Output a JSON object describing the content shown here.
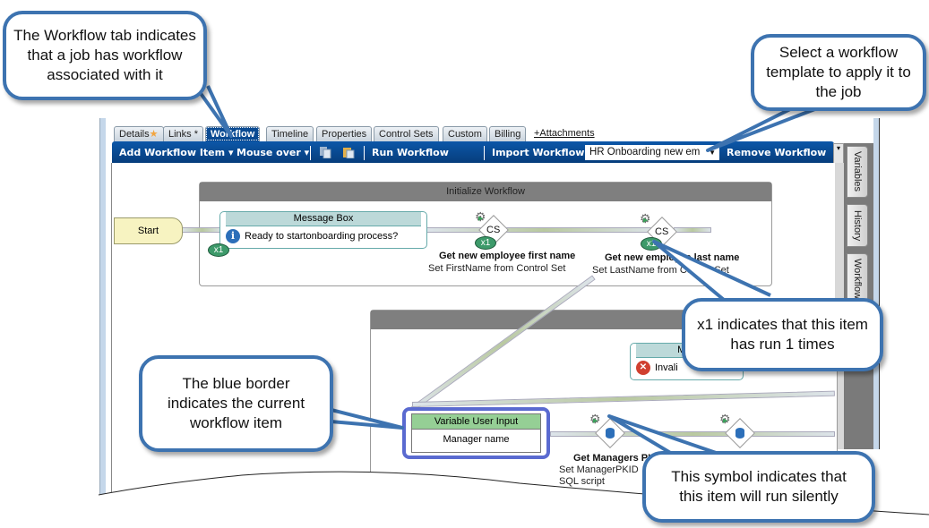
{
  "tabs": [
    {
      "label": "Details",
      "marker": "star"
    },
    {
      "label": "Links *"
    },
    {
      "label": "Workflow",
      "active": true
    },
    {
      "label": "Timeline"
    },
    {
      "label": "Properties"
    },
    {
      "label": "Control Sets"
    },
    {
      "label": "Custom"
    },
    {
      "label": "Billing"
    }
  ],
  "attachments_link": "+Attachments",
  "toolbar": {
    "add_item": "Add Workflow Item",
    "mouse_over": "Mouse over",
    "copy_icon": "copy-icon",
    "paste_icon": "paste-icon",
    "run": "Run Workflow",
    "import": "Import Workflow",
    "template_value": "HR Onboarding new em",
    "remove": "Remove Workflow"
  },
  "side_tabs": [
    "Variables",
    "History",
    "Workflow"
  ],
  "diagram": {
    "start": "Start",
    "group1": "Initialize Workflow",
    "message_box": {
      "title": "Message Box",
      "text": "Ready to startonboarding process?",
      "runs": "x1"
    },
    "cs_label": "CS",
    "node_first": {
      "title": "Get new employee first name",
      "subtitle": "Set FirstName from Control Set",
      "runs": "x1"
    },
    "node_last": {
      "title": "Get new employee last name",
      "subtitle": "Set LastName from Control Set",
      "runs": "x1"
    },
    "message_box2": {
      "title": "Mes",
      "text": "Invali"
    },
    "vui": {
      "title": "Variable User Input",
      "text": "Manager name"
    },
    "node_mgr": {
      "title": "Get Managers PK",
      "subtitle1": "Set ManagerPKID",
      "subtitle2": "SQL script"
    }
  },
  "callouts": {
    "workflow_tab": "The Workflow tab indicates that a job has workflow associated with it",
    "template": "Select a workflow template to apply it to the job",
    "run_count": "x1 indicates that this item has run 1 times",
    "blue_border": "The blue border indicates the current workflow item",
    "silent": "This symbol indicates that this item will run silently"
  },
  "colors": {
    "toolbar": "#0a4a92",
    "callout_border": "#3d73b0",
    "current_border": "#5a6ad0",
    "run_badge": "#3d9a6a"
  }
}
